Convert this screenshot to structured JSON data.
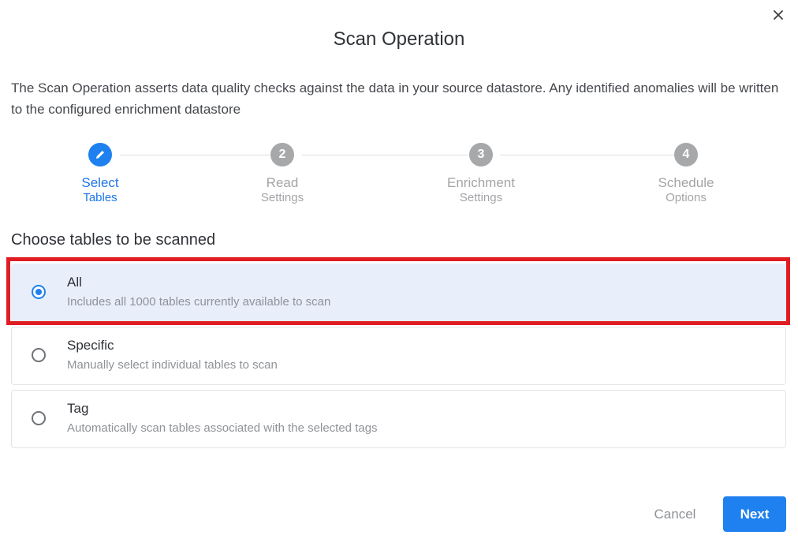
{
  "dialog": {
    "title": "Scan Operation",
    "description": "The Scan Operation asserts data quality checks against the data in your source datastore. Any identified anomalies will be written to the configured enrichment datastore",
    "close_icon": "close-icon"
  },
  "stepper": {
    "active_step": 1,
    "steps": [
      {
        "marker": "pencil-icon",
        "line1": "Select",
        "line2": "Tables"
      },
      {
        "marker": "2",
        "line1": "Read",
        "line2": "Settings"
      },
      {
        "marker": "3",
        "line1": "Enrichment",
        "line2": "Settings"
      },
      {
        "marker": "4",
        "line1": "Schedule",
        "line2": "Options"
      }
    ]
  },
  "section": {
    "title": "Choose tables to be scanned"
  },
  "options": [
    {
      "title": "All",
      "subtitle": "Includes all 1000 tables currently available to scan",
      "selected": true
    },
    {
      "title": "Specific",
      "subtitle": "Manually select individual tables to scan",
      "selected": false
    },
    {
      "title": "Tag",
      "subtitle": "Automatically scan tables associated with the selected tags",
      "selected": false
    }
  ],
  "footer": {
    "cancel_label": "Cancel",
    "next_label": "Next"
  },
  "colors": {
    "accent": "#1f80ef",
    "selected_bg": "#e8effb",
    "highlight_border": "#e11d24",
    "inactive_step": "#a7a8aa"
  }
}
